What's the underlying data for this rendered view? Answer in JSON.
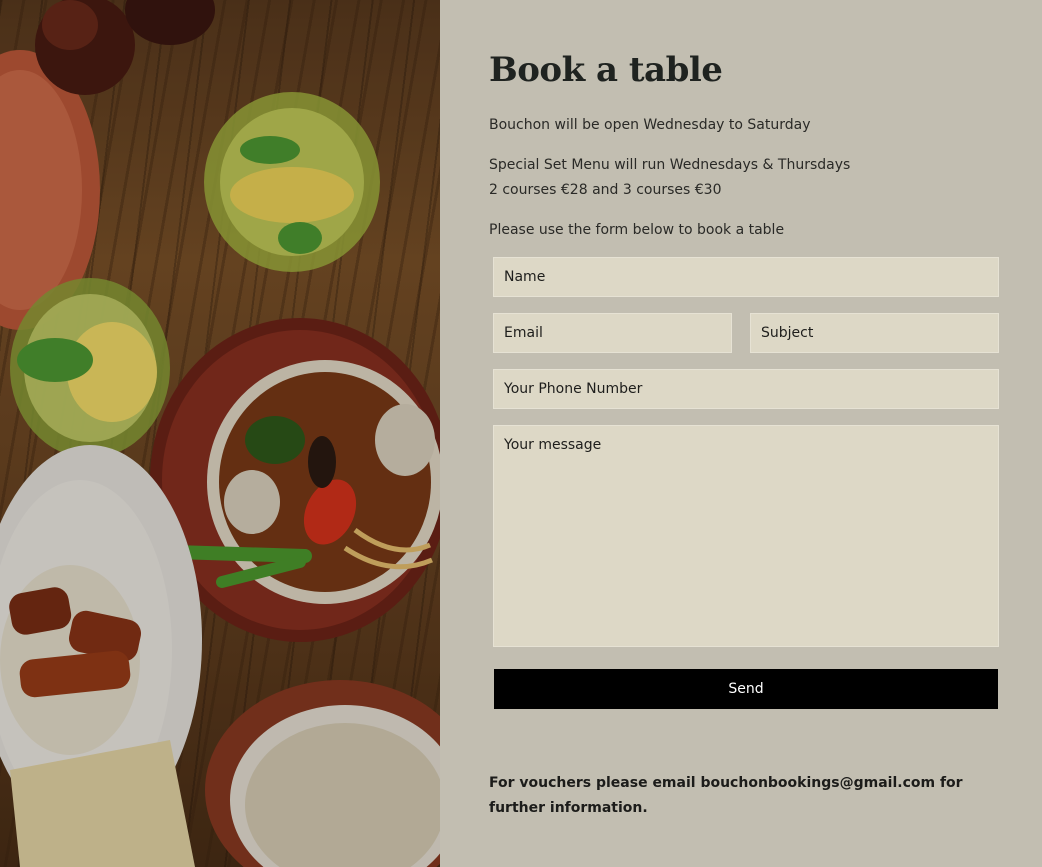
{
  "booking": {
    "title": "Book a table",
    "open_days": "Bouchon will be open Wednesday to Saturday",
    "set_menu_line1": "Special Set Menu will run Wednesdays & Thursdays",
    "set_menu_line2": "2 courses €28 and 3 courses €30",
    "form_intro": "Please use the form below to book a table"
  },
  "form": {
    "name_placeholder": "Name",
    "email_placeholder": "Email",
    "subject_placeholder": "Subject",
    "phone_placeholder": "Your Phone Number",
    "message_placeholder": "Your message",
    "send_label": "Send"
  },
  "footer": {
    "voucher_text_before": "For vouchers please email ",
    "voucher_email": "bouchonbookings@gmail.com",
    "voucher_text_after": " for further information."
  },
  "colors": {
    "panel_background": "#c2beb1",
    "field_background": "#ddd8c6",
    "button_background": "#000000",
    "button_text": "#ffffff",
    "heading_text": "#1f2320"
  }
}
